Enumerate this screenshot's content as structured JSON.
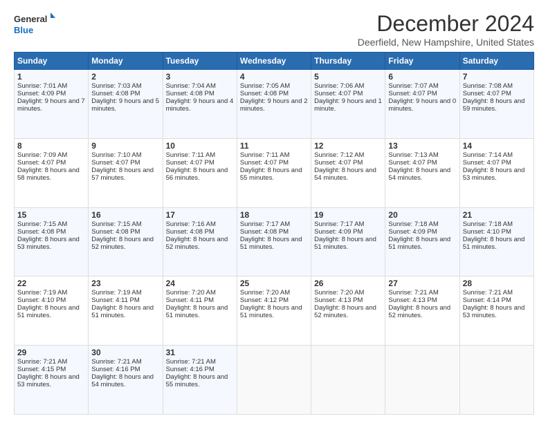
{
  "logo": {
    "line1": "General",
    "line2": "Blue"
  },
  "title": "December 2024",
  "location": "Deerfield, New Hampshire, United States",
  "headers": [
    "Sunday",
    "Monday",
    "Tuesday",
    "Wednesday",
    "Thursday",
    "Friday",
    "Saturday"
  ],
  "weeks": [
    [
      {
        "day": "1",
        "info": "Sunrise: 7:01 AM\nSunset: 4:09 PM\nDaylight: 9 hours and 7 minutes."
      },
      {
        "day": "2",
        "info": "Sunrise: 7:03 AM\nSunset: 4:08 PM\nDaylight: 9 hours and 5 minutes."
      },
      {
        "day": "3",
        "info": "Sunrise: 7:04 AM\nSunset: 4:08 PM\nDaylight: 9 hours and 4 minutes."
      },
      {
        "day": "4",
        "info": "Sunrise: 7:05 AM\nSunset: 4:08 PM\nDaylight: 9 hours and 2 minutes."
      },
      {
        "day": "5",
        "info": "Sunrise: 7:06 AM\nSunset: 4:07 PM\nDaylight: 9 hours and 1 minute."
      },
      {
        "day": "6",
        "info": "Sunrise: 7:07 AM\nSunset: 4:07 PM\nDaylight: 9 hours and 0 minutes."
      },
      {
        "day": "7",
        "info": "Sunrise: 7:08 AM\nSunset: 4:07 PM\nDaylight: 8 hours and 59 minutes."
      }
    ],
    [
      {
        "day": "8",
        "info": "Sunrise: 7:09 AM\nSunset: 4:07 PM\nDaylight: 8 hours and 58 minutes."
      },
      {
        "day": "9",
        "info": "Sunrise: 7:10 AM\nSunset: 4:07 PM\nDaylight: 8 hours and 57 minutes."
      },
      {
        "day": "10",
        "info": "Sunrise: 7:11 AM\nSunset: 4:07 PM\nDaylight: 8 hours and 56 minutes."
      },
      {
        "day": "11",
        "info": "Sunrise: 7:11 AM\nSunset: 4:07 PM\nDaylight: 8 hours and 55 minutes."
      },
      {
        "day": "12",
        "info": "Sunrise: 7:12 AM\nSunset: 4:07 PM\nDaylight: 8 hours and 54 minutes."
      },
      {
        "day": "13",
        "info": "Sunrise: 7:13 AM\nSunset: 4:07 PM\nDaylight: 8 hours and 54 minutes."
      },
      {
        "day": "14",
        "info": "Sunrise: 7:14 AM\nSunset: 4:07 PM\nDaylight: 8 hours and 53 minutes."
      }
    ],
    [
      {
        "day": "15",
        "info": "Sunrise: 7:15 AM\nSunset: 4:08 PM\nDaylight: 8 hours and 53 minutes."
      },
      {
        "day": "16",
        "info": "Sunrise: 7:15 AM\nSunset: 4:08 PM\nDaylight: 8 hours and 52 minutes."
      },
      {
        "day": "17",
        "info": "Sunrise: 7:16 AM\nSunset: 4:08 PM\nDaylight: 8 hours and 52 minutes."
      },
      {
        "day": "18",
        "info": "Sunrise: 7:17 AM\nSunset: 4:08 PM\nDaylight: 8 hours and 51 minutes."
      },
      {
        "day": "19",
        "info": "Sunrise: 7:17 AM\nSunset: 4:09 PM\nDaylight: 8 hours and 51 minutes."
      },
      {
        "day": "20",
        "info": "Sunrise: 7:18 AM\nSunset: 4:09 PM\nDaylight: 8 hours and 51 minutes."
      },
      {
        "day": "21",
        "info": "Sunrise: 7:18 AM\nSunset: 4:10 PM\nDaylight: 8 hours and 51 minutes."
      }
    ],
    [
      {
        "day": "22",
        "info": "Sunrise: 7:19 AM\nSunset: 4:10 PM\nDaylight: 8 hours and 51 minutes."
      },
      {
        "day": "23",
        "info": "Sunrise: 7:19 AM\nSunset: 4:11 PM\nDaylight: 8 hours and 51 minutes."
      },
      {
        "day": "24",
        "info": "Sunrise: 7:20 AM\nSunset: 4:11 PM\nDaylight: 8 hours and 51 minutes."
      },
      {
        "day": "25",
        "info": "Sunrise: 7:20 AM\nSunset: 4:12 PM\nDaylight: 8 hours and 51 minutes."
      },
      {
        "day": "26",
        "info": "Sunrise: 7:20 AM\nSunset: 4:13 PM\nDaylight: 8 hours and 52 minutes."
      },
      {
        "day": "27",
        "info": "Sunrise: 7:21 AM\nSunset: 4:13 PM\nDaylight: 8 hours and 52 minutes."
      },
      {
        "day": "28",
        "info": "Sunrise: 7:21 AM\nSunset: 4:14 PM\nDaylight: 8 hours and 53 minutes."
      }
    ],
    [
      {
        "day": "29",
        "info": "Sunrise: 7:21 AM\nSunset: 4:15 PM\nDaylight: 8 hours and 53 minutes."
      },
      {
        "day": "30",
        "info": "Sunrise: 7:21 AM\nSunset: 4:16 PM\nDaylight: 8 hours and 54 minutes."
      },
      {
        "day": "31",
        "info": "Sunrise: 7:21 AM\nSunset: 4:16 PM\nDaylight: 8 hours and 55 minutes."
      },
      {
        "day": "",
        "info": ""
      },
      {
        "day": "",
        "info": ""
      },
      {
        "day": "",
        "info": ""
      },
      {
        "day": "",
        "info": ""
      }
    ]
  ]
}
